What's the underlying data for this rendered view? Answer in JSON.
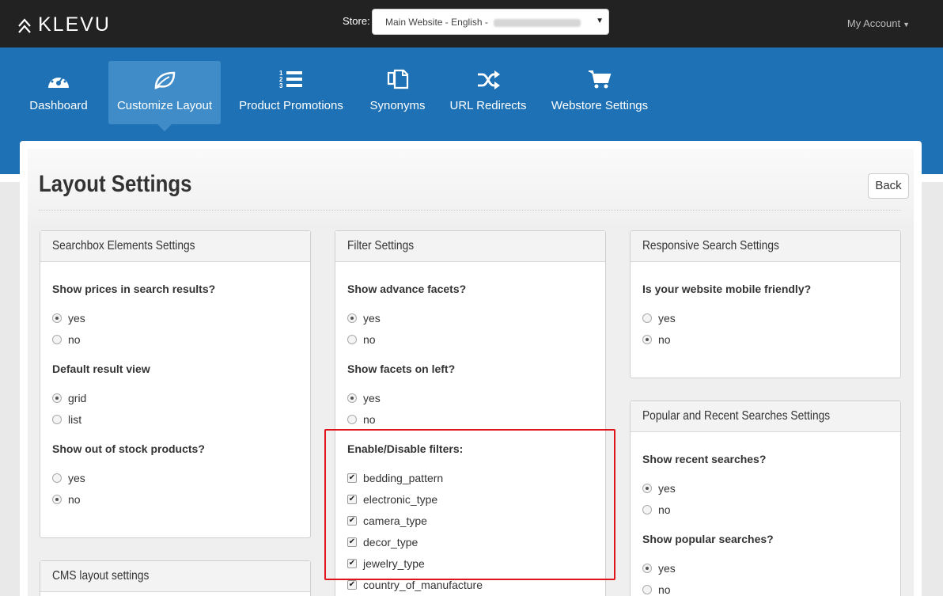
{
  "brand": {
    "name": "KLEVU"
  },
  "store": {
    "label": "Store:",
    "selected": "Main Website - English - "
  },
  "account": {
    "label": "My Account"
  },
  "nav": {
    "items": [
      {
        "label": "Dashboard",
        "icon": "dashboard-icon"
      },
      {
        "label": "Customize Layout",
        "icon": "leaf-icon",
        "active": true
      },
      {
        "label": "Product Promotions",
        "icon": "ordered-list-icon"
      },
      {
        "label": "Synonyms",
        "icon": "copy-icon"
      },
      {
        "label": "URL Redirects",
        "icon": "shuffle-icon"
      },
      {
        "label": "Webstore Settings",
        "icon": "cart-icon"
      }
    ]
  },
  "page": {
    "title": "Layout Settings",
    "back_label": "Back"
  },
  "searchbox": {
    "title": "Searchbox Elements Settings",
    "q1": "Show prices in search results?",
    "q1_opts": [
      "yes",
      "no"
    ],
    "q2": "Default result view",
    "q2_opts": [
      "grid",
      "list"
    ],
    "q3": "Show out of stock products?",
    "q3_opts": [
      "yes",
      "no"
    ]
  },
  "cms": {
    "title": "CMS layout settings"
  },
  "filters": {
    "title": "Filter Settings",
    "q1": "Show advance facets?",
    "q1_opts": [
      "yes",
      "no"
    ],
    "q2": "Show facets on left?",
    "q2_opts": [
      "yes",
      "no"
    ],
    "q3": "Enable/Disable filters:",
    "items": [
      "bedding_pattern",
      "electronic_type",
      "camera_type",
      "decor_type",
      "jewelry_type",
      "country_of_manufacture"
    ]
  },
  "responsive": {
    "title": "Responsive Search Settings",
    "q1": "Is your website mobile friendly?",
    "q1_opts": [
      "yes",
      "no"
    ]
  },
  "popular": {
    "title": "Popular and Recent Searches Settings",
    "q1": "Show recent searches?",
    "q1_opts": [
      "yes",
      "no"
    ],
    "q2": "Show popular searches?",
    "q2_opts": [
      "yes",
      "no"
    ]
  },
  "colors": {
    "topbar": "#222222",
    "nav": "#1e71b4",
    "nav_active": "#3f8cc8",
    "highlight": "#e0141b"
  }
}
